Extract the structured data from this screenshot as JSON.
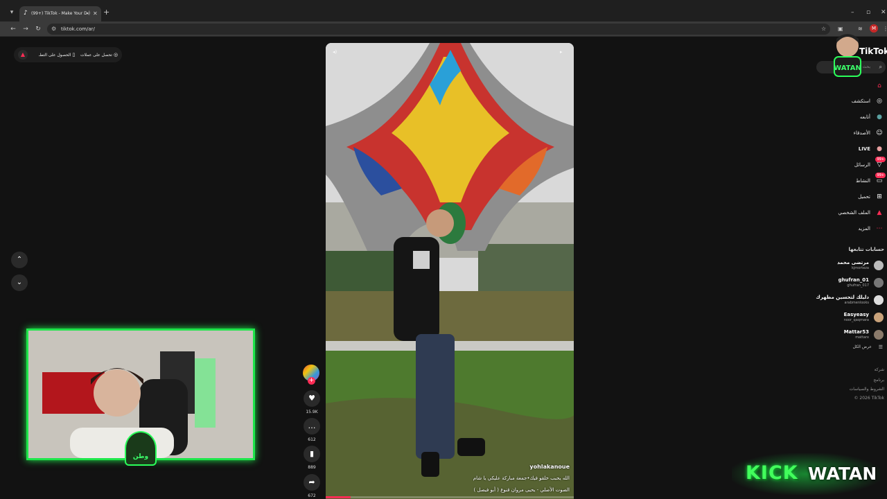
{
  "browser": {
    "tab_title": "(99+) TikTok - Make Your Day",
    "tab_favicon": "tiktok-icon",
    "url": "tiktok.com/ar/"
  },
  "colors": {
    "accent": "#fe2c55",
    "kick_green": "#1ee64a",
    "background": "#121212"
  },
  "top_left": {
    "get_coins": "تحصل على عملات",
    "get_app": "الحصول على التطـ"
  },
  "video": {
    "author": "yohlakanoue",
    "caption": "الله يحبب خلقو فيك•جمعة مباركة عليكي يا شام",
    "sound": "الصوت الأصلي - يحيى مروان قنوع ( أبو فيصل )",
    "progress": 0.1
  },
  "actions": {
    "likes": "15.9K",
    "comments": "612",
    "saves": "889",
    "shares": "672"
  },
  "sidebar": {
    "brand": "TikTok",
    "search_placeholder": "بحث",
    "nav": [
      {
        "label": "استكشف",
        "icon": "compass-icon"
      },
      {
        "label": "أتابعه",
        "icon": "avatar-icon"
      },
      {
        "label": "الأصدقاء",
        "icon": "friends-icon"
      },
      {
        "label": "LIVE",
        "icon": "live-icon"
      },
      {
        "label": "الرسائل",
        "icon": "messages-icon",
        "badge": "99+"
      },
      {
        "label": "النشاط",
        "icon": "activity-icon",
        "badge": "99+"
      },
      {
        "label": "تحميل",
        "icon": "upload-icon"
      },
      {
        "label": "الملف الشخصي",
        "icon": "profile-icon"
      },
      {
        "label": "المزيد",
        "icon": "more-icon"
      }
    ],
    "following_header": "حسابات تتابعها",
    "following": [
      {
        "name": "مرتضى محمد",
        "handle": "kjmorteza",
        "color": "#bbbbbb"
      },
      {
        "name": "ghufran_01",
        "handle": "ghufran_017",
        "color": "#777777"
      },
      {
        "name": "دليلك لتحسين مظهرك",
        "handle": "arabmenlooks",
        "color": "#dddddd"
      },
      {
        "name": "Easyeasy",
        "handle": "noor_qaqmara",
        "color": "#c9a27a"
      },
      {
        "name": "Mattar53",
        "handle": "mattarx",
        "color": "#8a7a6a"
      }
    ],
    "see_all": "عرض الكل",
    "footer": [
      "شركة",
      "برنامج",
      "الشروط والسياسات",
      "© 2026 TikTok"
    ]
  },
  "overlay": {
    "kick_word": "KICK",
    "kick_name": "WATAN",
    "cam_tag": "وطن",
    "badge_text": "WATAN"
  }
}
